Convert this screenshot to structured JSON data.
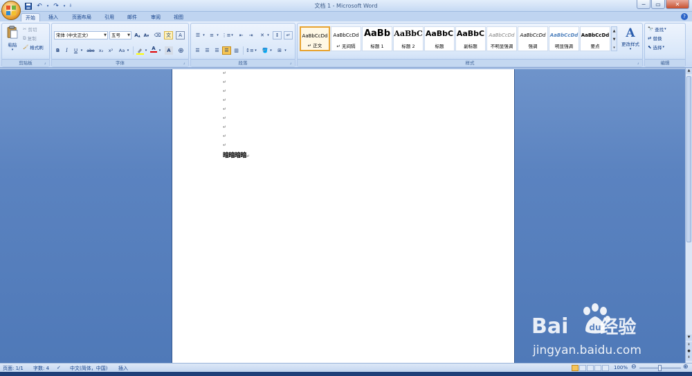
{
  "window": {
    "title": "文档 1 - Microsoft Word",
    "min": "─",
    "max": "▭",
    "close": "✕"
  },
  "qat": [
    "save-icon",
    "undo-icon",
    "redo-icon",
    "customize-icon"
  ],
  "tabs": [
    {
      "label": "开始",
      "active": true
    },
    {
      "label": "插入"
    },
    {
      "label": "页面布局"
    },
    {
      "label": "引用"
    },
    {
      "label": "邮件"
    },
    {
      "label": "审阅"
    },
    {
      "label": "视图"
    }
  ],
  "clipboard": {
    "paste": "粘贴",
    "cut": "剪切",
    "copy": "复制",
    "format_painter": "格式刷",
    "group": "剪贴板"
  },
  "font": {
    "family": "宋体 (中文正文)",
    "size": "五号",
    "group": "字体",
    "bold": "B",
    "italic": "I",
    "underline": "U",
    "strike": "abe",
    "sub": "x₂",
    "sup": "x²",
    "case": "Aa",
    "grow": "A",
    "shrink": "A",
    "color_a": "A",
    "highlight_color": "#ffff00",
    "font_color": "#e00000"
  },
  "paragraph": {
    "group": "段落"
  },
  "styles": {
    "group": "样式",
    "items": [
      {
        "sample": "AaBbCcDd",
        "name": "正文",
        "selected": true,
        "check": "↵"
      },
      {
        "sample": "AaBbCcDd",
        "name": "无间隔",
        "check": "↵"
      },
      {
        "sample": "AaBb",
        "name": "标题 1"
      },
      {
        "sample": "AaBbC",
        "name": "标题 2"
      },
      {
        "sample": "AaBbC",
        "name": "标题"
      },
      {
        "sample": "AaBbC",
        "name": "副标题"
      },
      {
        "sample": "AaBbCcDd",
        "name": "不明显强调"
      },
      {
        "sample": "AaBbCcDd",
        "name": "强调"
      },
      {
        "sample": "AaBbCcDd",
        "name": "明显强调"
      },
      {
        "sample": "AaBbCcDd",
        "name": "要点"
      }
    ],
    "change": "更改样式"
  },
  "editing": {
    "group": "编辑",
    "find": "查找",
    "replace": "替换",
    "select": "选择"
  },
  "document": {
    "paragraph_mark": "↵",
    "text": "暗暗暗暗"
  },
  "status": {
    "page": "页面: 1/1",
    "words": "字数: 4",
    "language": "中文(简体，中国)",
    "mode": "插入",
    "zoom": "100%"
  },
  "watermark": {
    "logo": "Bai",
    "logo_cn": "经验",
    "logo_du": "du",
    "url": "jingyan.baidu.com"
  }
}
